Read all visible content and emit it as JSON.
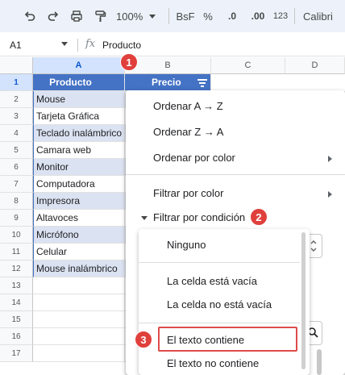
{
  "toolbar": {
    "zoom": "100%",
    "number_format": "BsF",
    "percent": "%",
    "dec_less": ".0",
    "dec_more": ".00",
    "num123": "123",
    "font": "Calibri"
  },
  "formula_bar": {
    "cell_ref": "A1",
    "fx": "fx",
    "value": "Producto"
  },
  "columns": [
    "A",
    "B",
    "C",
    "D"
  ],
  "rows": [
    "1",
    "2",
    "3",
    "4",
    "5",
    "6",
    "7",
    "8",
    "9",
    "10",
    "11",
    "12",
    "13",
    "14",
    "15",
    "16",
    "17"
  ],
  "table": {
    "headers": {
      "a": "Producto",
      "b": "Precio"
    },
    "products": [
      "Mouse",
      "Tarjeta Gráfica",
      "Teclado inalámbrico",
      "Camara web",
      "Monitor",
      "Computadora",
      "Impresora",
      "Altavoces",
      "Micrófono",
      "Celular",
      "Mouse inalámbrico"
    ]
  },
  "menu": {
    "sort_az": "Ordenar A → Z",
    "sort_za": "Ordenar Z → A",
    "sort_color": "Ordenar por color",
    "filter_color": "Filtrar por color",
    "filter_condition": "Filtrar por condición"
  },
  "conditions": {
    "none": "Ninguno",
    "empty": "La celda está vacía",
    "not_empty": "La celda no está vacía",
    "text_contains": "El texto contiene",
    "text_not_contains": "El texto no contiene"
  },
  "badges": {
    "one": "1",
    "two": "2",
    "three": "3"
  },
  "colors": {
    "header_fill": "#4472c4",
    "band_fill": "#dbe2f1",
    "badge": "#e0403c",
    "toolbar_bg": "#edf2fa",
    "selection": "#d3e3fd"
  }
}
